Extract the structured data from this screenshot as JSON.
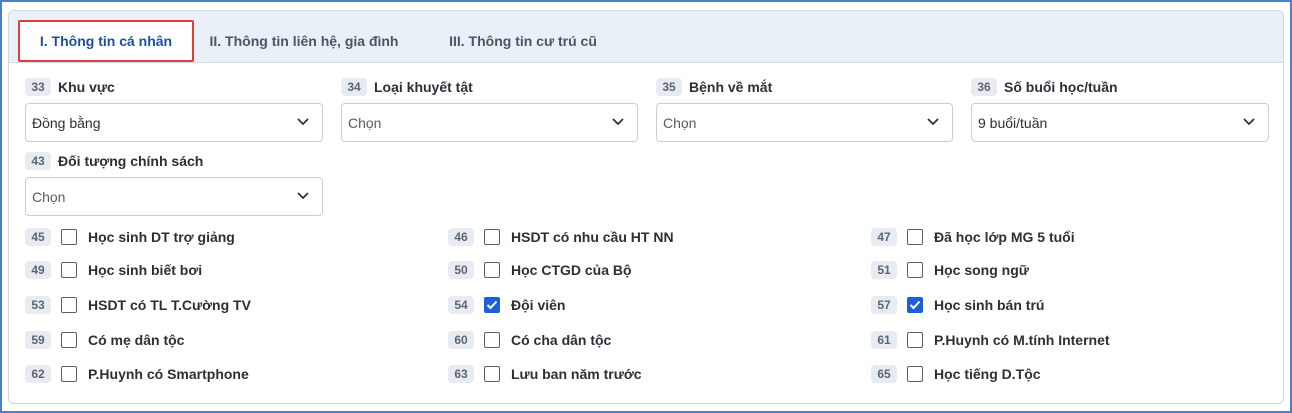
{
  "tabs": [
    {
      "label": "I. Thông tin cá nhân",
      "active": true
    },
    {
      "label": "II. Thông tin liên hệ, gia đình",
      "active": false
    },
    {
      "label": "III. Thông tin cư trú cũ",
      "active": false
    }
  ],
  "fields": [
    {
      "num": "33",
      "label": "Khu vực",
      "value": "Đồng bằng"
    },
    {
      "num": "34",
      "label": "Loại khuyết tật",
      "value": "Chọn"
    },
    {
      "num": "35",
      "label": "Bệnh về mắt",
      "value": "Chọn"
    },
    {
      "num": "36",
      "label": "Số buổi học/tuần",
      "value": "9 buổi/tuần"
    },
    {
      "num": "43",
      "label": "Đối tượng chính sách",
      "value": "Chọn"
    }
  ],
  "checkboxes": [
    {
      "num": "45",
      "label": "Học sinh DT trợ giảng",
      "checked": false
    },
    {
      "num": "46",
      "label": "HSDT có nhu cầu HT NN",
      "checked": false
    },
    {
      "num": "47",
      "label": "Đã học lớp MG 5 tuổi",
      "checked": false
    },
    {
      "num": "49",
      "label": "Học sinh biết bơi",
      "checked": false
    },
    {
      "num": "50",
      "label": "Học CTGD của Bộ",
      "checked": false
    },
    {
      "num": "51",
      "label": "Học song ngữ",
      "checked": false
    },
    {
      "num": "53",
      "label": "HSDT có TL T.Cường TV",
      "checked": false
    },
    {
      "num": "54",
      "label": "Đội viên",
      "checked": true
    },
    {
      "num": "57",
      "label": "Học sinh bán trú",
      "checked": true
    },
    {
      "num": "59",
      "label": "Có mẹ dân tộc",
      "checked": false
    },
    {
      "num": "60",
      "label": "Có cha dân tộc",
      "checked": false
    },
    {
      "num": "61",
      "label": "P.Huynh có M.tính Internet",
      "checked": false
    },
    {
      "num": "62",
      "label": "P.Huynh có Smartphone",
      "checked": false
    },
    {
      "num": "63",
      "label": "Lưu ban năm trước",
      "checked": false
    },
    {
      "num": "65",
      "label": "Học tiếng D.Tộc",
      "checked": false
    }
  ],
  "icons": {
    "dropdown": "chevron-down-icon",
    "check": "checkmark-icon"
  },
  "colors": {
    "accent": "#1d5fd6",
    "active_tab_border": "#e03c3c",
    "active_tab_text": "#1d4f9f",
    "tabbar_bg": "#eaf0f8"
  }
}
